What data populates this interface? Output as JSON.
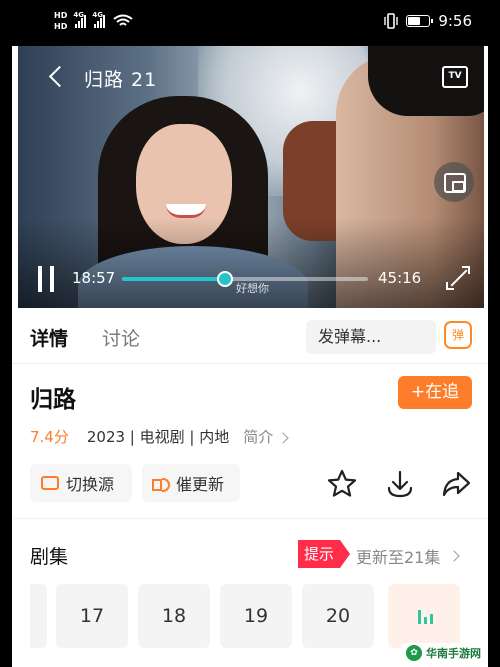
{
  "status_bar": {
    "hd_top": "HD",
    "hd_bottom": "HD",
    "sim1": "4G",
    "sim2": "4G",
    "time": "9:56",
    "icons": [
      "vibrate-icon",
      "battery-icon",
      "wifi-icon"
    ]
  },
  "player": {
    "title": "归路 21",
    "tv_label": "TV",
    "current_time": "18:57",
    "total_time": "45:16",
    "progress": 0.42,
    "danmu_text": "好想你",
    "accent_color": "#23c6c8"
  },
  "tabs": {
    "details": "详情",
    "discussion": "讨论",
    "danmu_placeholder": "发弹幕...",
    "danmu_toggle_label": "弹"
  },
  "info": {
    "title": "归路",
    "follow_label": "+在追",
    "score": "7.4分",
    "meta": "2023 | 电视剧 | 内地",
    "intro_label": "简介",
    "switch_source_label": "切换源",
    "urge_update_label": "催更新",
    "accent_color": "#fd7d2a"
  },
  "episodes": {
    "title": "剧集",
    "hint": "提示",
    "update_label": "更新至21集",
    "items": [
      "17",
      "18",
      "19",
      "20"
    ]
  },
  "watermark": {
    "text": "华南手游网"
  }
}
